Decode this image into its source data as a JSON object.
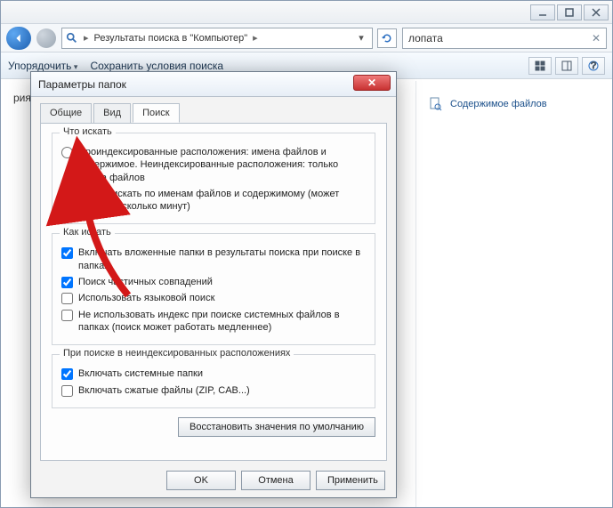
{
  "window": {
    "min": "",
    "max": "",
    "close": ""
  },
  "breadcrumb": {
    "text": "Результаты поиска в \"Компьютер\""
  },
  "search": {
    "value": "лопата"
  },
  "cmdbar": {
    "organize": "Упорядочить",
    "save": "Сохранить условия поиска"
  },
  "results": {
    "none_suffix": "риям поиска, не найдены."
  },
  "sidepanel": {
    "content_files": "Содержимое файлов"
  },
  "dialog": {
    "title": "Параметры папок",
    "tabs": {
      "general": "Общие",
      "view": "Вид",
      "search": "Поиск"
    },
    "grp_what": {
      "legend": "Что искать",
      "r1": "Проиндексированные расположения: имена файлов и содержимое. Неиндексированные расположения: только имена файлов",
      "r2": "Всегда искать по именам файлов и содержимому (может занять несколько минут)"
    },
    "grp_how": {
      "legend": "Как искать",
      "c1": "Включать вложенные папки в результаты поиска при поиске в папках",
      "c2": "Поиск частичных совпадений",
      "c3": "Использовать языковой поиск",
      "c4": "Не использовать индекс при поиске системных файлов в папках (поиск может работать медленнее)"
    },
    "grp_nonidx": {
      "legend": "При поиске в неиндексированных расположениях",
      "c1": "Включать системные папки",
      "c2": "Включать сжатые файлы (ZIP, CAB...)"
    },
    "restore": "Восстановить значения по умолчанию",
    "ok": "OK",
    "cancel": "Отмена",
    "apply": "Применить"
  }
}
